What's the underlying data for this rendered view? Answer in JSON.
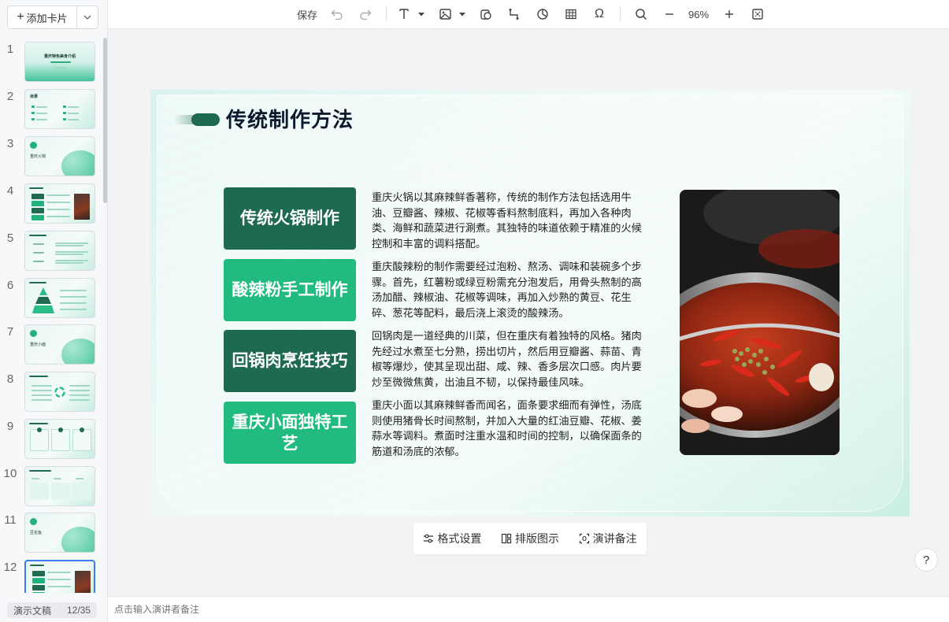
{
  "sidebar": {
    "add_card_label": "添加卡片",
    "slides": [
      {
        "num": "1",
        "title": "重庆特色美食介绍"
      },
      {
        "num": "2",
        "title": "目录"
      },
      {
        "num": "3",
        "title": "重庆火锅"
      },
      {
        "num": "4",
        "title": ""
      },
      {
        "num": "5",
        "title": ""
      },
      {
        "num": "6",
        "title": ""
      },
      {
        "num": "7",
        "title": "重庆小面"
      },
      {
        "num": "8",
        "title": ""
      },
      {
        "num": "9",
        "title": ""
      },
      {
        "num": "10",
        "title": ""
      },
      {
        "num": "11",
        "title": "豆花鱼"
      },
      {
        "num": "12",
        "title": ""
      }
    ],
    "active_index": 12,
    "doc_label": "演示文稿",
    "page_counter": "12/35"
  },
  "toolbar": {
    "save_label": "保存",
    "zoom": "96%"
  },
  "slide": {
    "title": "传统制作方法",
    "items": [
      {
        "label": "传统火锅制作",
        "style": "dark",
        "text": "重庆火锅以其麻辣鲜香著称，传统的制作方法包括选用牛油、豆瓣酱、辣椒、花椒等香料熬制底料，再加入各种肉类、海鲜和蔬菜进行涮煮。其独特的味道依赖于精准的火候控制和丰富的调料搭配。"
      },
      {
        "label": "酸辣粉手工制作",
        "style": "light",
        "text": "重庆酸辣粉的制作需要经过泡粉、熬汤、调味和装碗多个步骤。首先，红薯粉或绿豆粉需充分泡发后，用骨头熬制的高汤加醋、辣椒油、花椒等调味，再加入炒熟的黄豆、花生碎、葱花等配料，最后浇上滚烫的酸辣汤。"
      },
      {
        "label": "回锅肉烹饪技巧",
        "style": "dark",
        "text": "回锅肉是一道经典的川菜，但在重庆有着独特的风格。猪肉先经过水煮至七分熟，捞出切片，然后用豆瓣酱、蒜苗、青椒等爆炒，使其呈现出甜、咸、辣、香多层次口感。肉片要炒至微微焦黄，出油且不韧，以保持最佳风味。"
      },
      {
        "label": "重庆小面独特工艺",
        "style": "light",
        "text": "重庆小面以其麻辣鲜香而闻名，面条要求细而有弹性，汤底则使用猪骨长时间熬制，并加入大量的红油豆瓣、花椒、姜蒜水等调料。煮面时注重水温和时间的控制，以确保面条的筋道和汤底的浓郁。"
      }
    ]
  },
  "bottom_tabs": {
    "format": "格式设置",
    "layout": "排版图示",
    "notes": "演讲备注"
  },
  "help_label": "?",
  "notes": {
    "placeholder": "点击输入演讲者备注"
  }
}
